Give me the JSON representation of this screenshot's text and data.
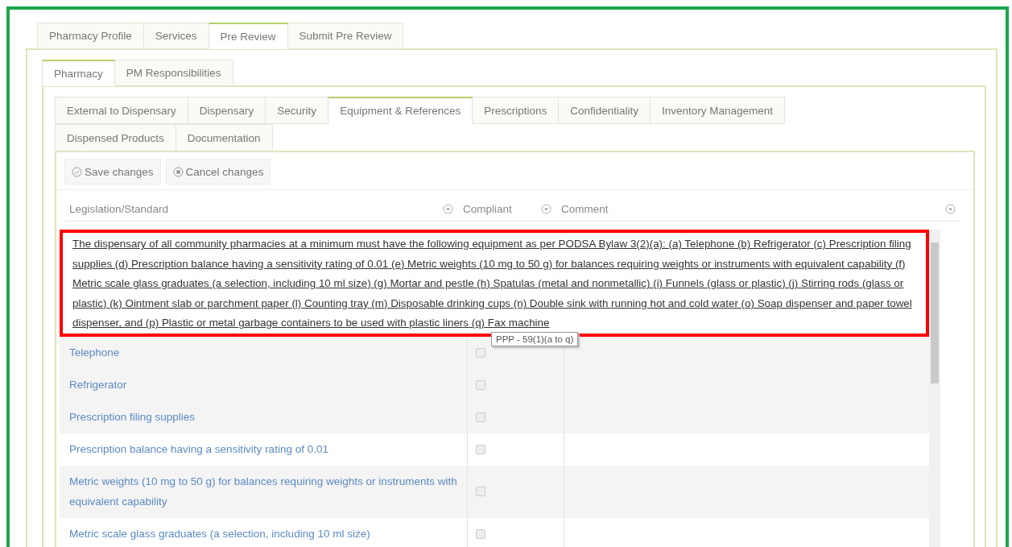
{
  "main_tabs": [
    {
      "label": "Pharmacy Profile",
      "selected": false
    },
    {
      "label": "Services",
      "selected": false
    },
    {
      "label": "Pre Review",
      "selected": true
    },
    {
      "label": "Submit Pre Review",
      "selected": false
    }
  ],
  "sub_tabs": [
    {
      "label": "Pharmacy",
      "selected": true
    },
    {
      "label": "PM Responsibilities",
      "selected": false
    }
  ],
  "section_tabs": [
    [
      {
        "label": "External to Dispensary",
        "selected": false
      },
      {
        "label": "Dispensary",
        "selected": false
      },
      {
        "label": "Security",
        "selected": false
      },
      {
        "label": "Equipment & References",
        "selected": true
      },
      {
        "label": "Prescriptions",
        "selected": false
      },
      {
        "label": "Confidentiality",
        "selected": false
      },
      {
        "label": "Inventory Management",
        "selected": false
      }
    ],
    [
      {
        "label": "Dispensed Products",
        "selected": false
      },
      {
        "label": "Documentation",
        "selected": false
      }
    ]
  ],
  "toolbar": [
    {
      "kind": "save",
      "label": "Save changes"
    },
    {
      "kind": "cancel",
      "label": "Cancel changes"
    }
  ],
  "table": {
    "columns": [
      "Legislation/Standard",
      "Compliant",
      "Comment"
    ],
    "group_text": "The dispensary of all community pharmacies at a minimum must have the following equipment as per PODSA Bylaw 3(2)(a): (a) Telephone (b) Refrigerator (c) Prescription filing supplies (d) Prescription balance having a sensitivity rating of 0.01 (e) Metric weights (10 mg to 50 g) for balances requiring weights or instruments with equivalent capability (f) Metric scale glass graduates (a selection, including 10 ml size) (g) Mortar and pestle (h) Spatulas (metal and nonmetallic) (i) Funnels (glass or plastic) (j) Stirring rods (glass or plastic) (k) Ointment slab or parchment paper (l) Counting tray (m) Disposable drinking cups (n) Double sink with running hot and cold water (o) Soap dispenser and paper towel dispenser, and (p) Plastic or metal garbage containers to be used with plastic liners (q) Fax machine",
    "tooltip": "PPP - 59(1)(a to q)",
    "rows": [
      {
        "label": "Telephone",
        "checked": false
      },
      {
        "label": "Refrigerator",
        "checked": false
      },
      {
        "label": "Prescription filing supplies",
        "checked": false
      },
      {
        "label": "Prescription balance having a sensitivity rating of 0.01",
        "checked": false
      },
      {
        "label": "Metric weights (10 mg to 50 g) for balances requiring weights or instruments with equivalent capability",
        "checked": false
      },
      {
        "label": "Metric scale glass graduates (a selection, including 10 ml size)",
        "checked": false
      }
    ]
  }
}
